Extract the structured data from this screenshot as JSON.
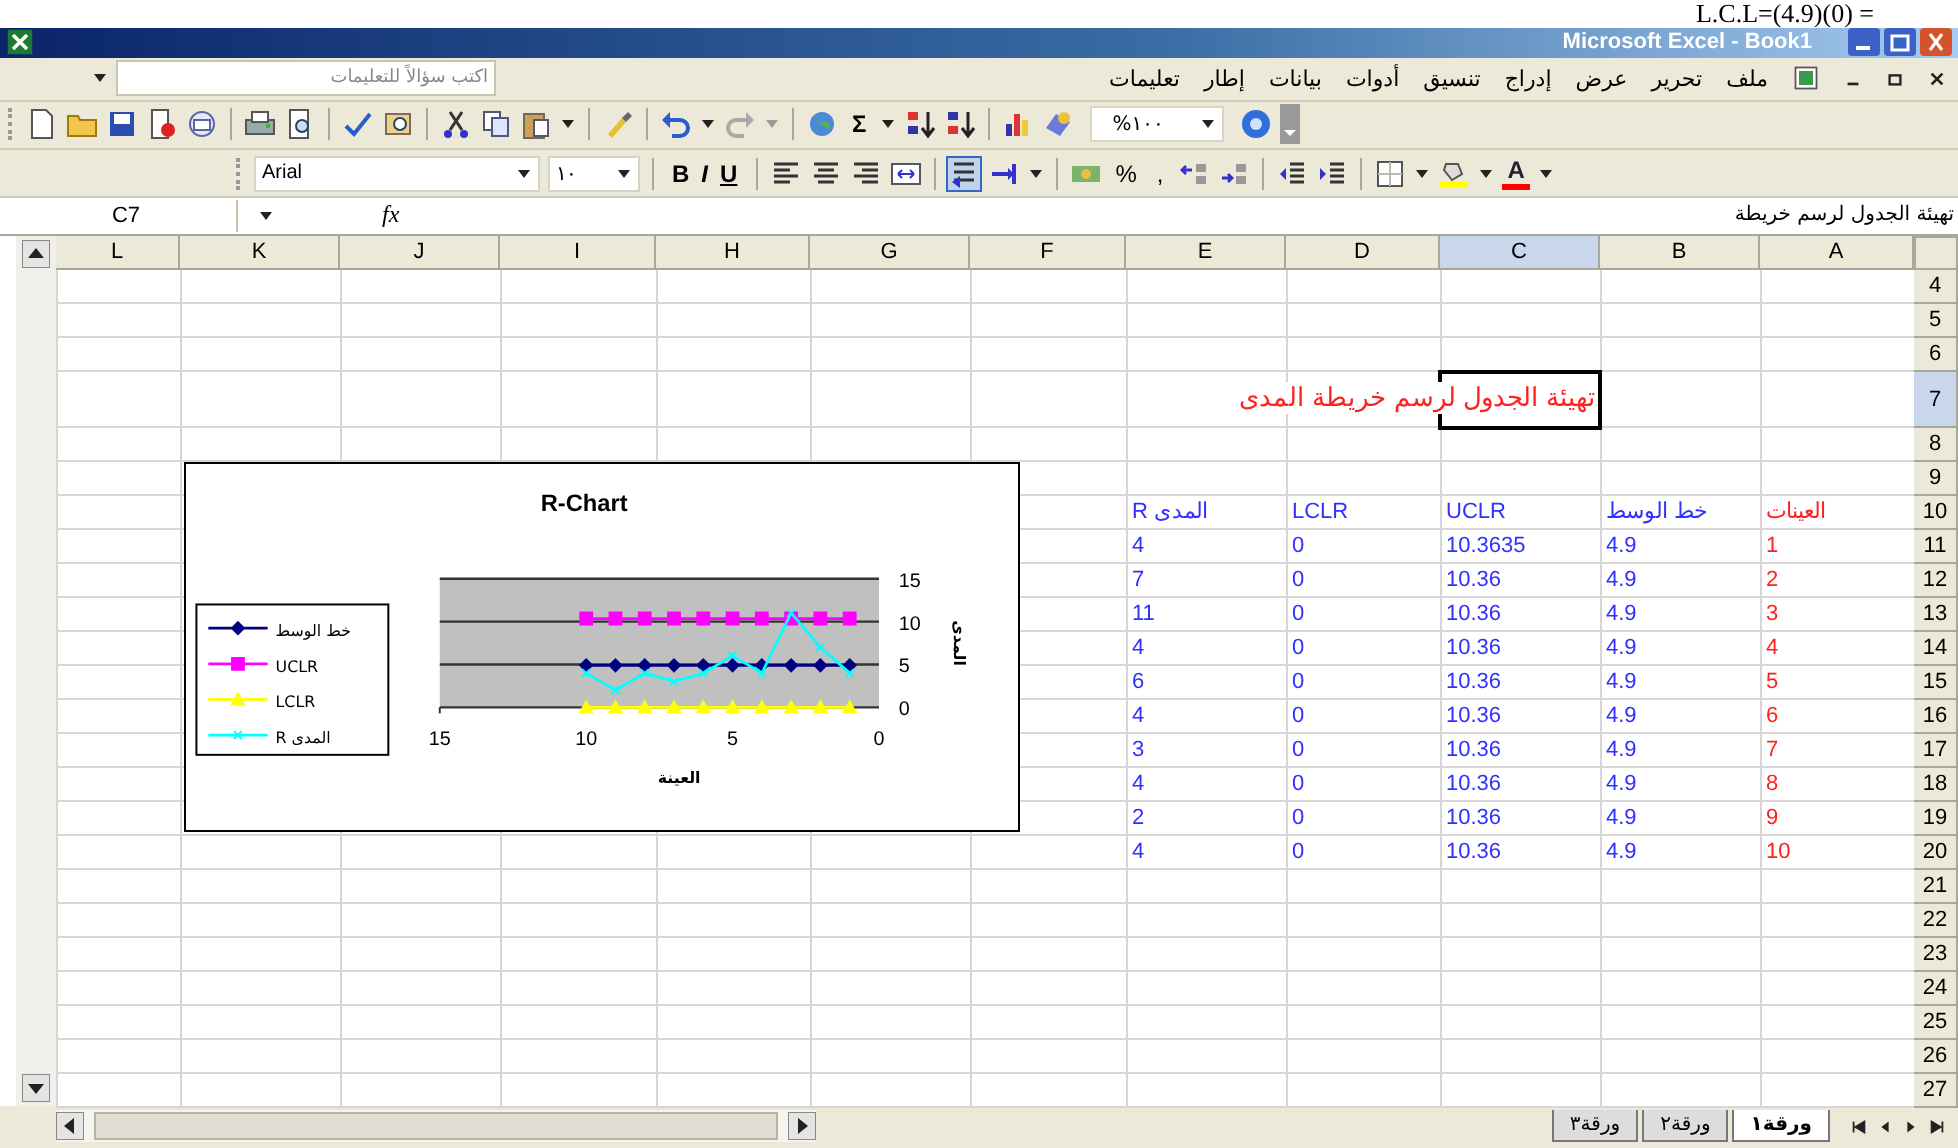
{
  "overlay_text": "L.C.L=(4.9)(0) =",
  "window": {
    "title": "Microsoft Excel - Book1"
  },
  "menu": [
    "ملف",
    "تحرير",
    "عرض",
    "إدراج",
    "تنسيق",
    "أدوات",
    "بيانات",
    "إطار",
    "تعليمات"
  ],
  "help_box": {
    "placeholder": "اكتب سؤالاً للتعليمات"
  },
  "standard_toolbar": {
    "autosum": "Σ",
    "zoom": "%١٠٠"
  },
  "formatting_toolbar": {
    "font": "Arial",
    "size": "١٠",
    "styles": [
      {
        "kind": "underline",
        "label": "U"
      },
      {
        "kind": "italic",
        "label": "I"
      },
      {
        "kind": "bold",
        "label": "B"
      }
    ],
    "percent": "%",
    "comma": ",",
    "font_color": "A"
  },
  "formula_bar": {
    "name_box": "C7",
    "fx": "fx",
    "content": "تهيئة الجدول لرسم خريطة"
  },
  "sheet": {
    "columns": [
      {
        "label": "A",
        "selected": false
      },
      {
        "label": "B",
        "selected": false
      },
      {
        "label": "C",
        "selected": true
      },
      {
        "label": "D",
        "selected": false
      },
      {
        "label": "E",
        "selected": false
      },
      {
        "label": "F",
        "selected": false
      },
      {
        "label": "G",
        "selected": false
      },
      {
        "label": "H",
        "selected": false
      },
      {
        "label": "I",
        "selected": false
      },
      {
        "label": "J",
        "selected": false
      },
      {
        "label": "K",
        "selected": false
      },
      {
        "label": "L",
        "selected": false
      }
    ],
    "rows": [
      {
        "label": "4",
        "selected": false
      },
      {
        "label": "5",
        "selected": false
      },
      {
        "label": "6",
        "selected": false
      },
      {
        "label": "7",
        "selected": true,
        "note": "تهيئة الجدول لرسم خريطة المدى"
      },
      {
        "label": "8",
        "selected": false
      },
      {
        "label": "9",
        "selected": false
      },
      {
        "label": "10",
        "selected": false,
        "cells": [
          "العينات",
          "خط الوسط",
          "UCLR",
          "LCLR",
          "R المدى"
        ]
      },
      {
        "label": "11",
        "selected": false,
        "cells": [
          "1",
          "4.9",
          "10.3635",
          "0",
          "4"
        ]
      },
      {
        "label": "12",
        "selected": false,
        "cells": [
          "2",
          "4.9",
          "10.36",
          "0",
          "7"
        ]
      },
      {
        "label": "13",
        "selected": false,
        "cells": [
          "3",
          "4.9",
          "10.36",
          "0",
          "11"
        ]
      },
      {
        "label": "14",
        "selected": false,
        "cells": [
          "4",
          "4.9",
          "10.36",
          "0",
          "4"
        ]
      },
      {
        "label": "15",
        "selected": false,
        "cells": [
          "5",
          "4.9",
          "10.36",
          "0",
          "6"
        ]
      },
      {
        "label": "16",
        "selected": false,
        "cells": [
          "6",
          "4.9",
          "10.36",
          "0",
          "4"
        ]
      },
      {
        "label": "17",
        "selected": false,
        "cells": [
          "7",
          "4.9",
          "10.36",
          "0",
          "3"
        ]
      },
      {
        "label": "18",
        "selected": false,
        "cells": [
          "8",
          "4.9",
          "10.36",
          "0",
          "4"
        ]
      },
      {
        "label": "19",
        "selected": false,
        "cells": [
          "9",
          "4.9",
          "10.36",
          "0",
          "2"
        ]
      },
      {
        "label": "20",
        "selected": false,
        "cells": [
          "10",
          "4.9",
          "10.36",
          "0",
          "4"
        ]
      },
      {
        "label": "21",
        "selected": false
      },
      {
        "label": "22",
        "selected": false
      },
      {
        "label": "23",
        "selected": false
      },
      {
        "label": "24",
        "selected": false
      },
      {
        "label": "25",
        "selected": false
      },
      {
        "label": "26",
        "selected": false
      },
      {
        "label": "27",
        "selected": false
      }
    ]
  },
  "chart": {
    "chart_data": {
      "type": "line",
      "title": "R-Chart",
      "xlabel": "العينة",
      "ylabel": "المدى",
      "x": [
        1,
        2,
        3,
        4,
        5,
        6,
        7,
        8,
        9,
        10
      ],
      "legend": "left",
      "series": [
        {
          "name": "خط الوسط",
          "color": "#000080",
          "marker": "diamond",
          "values": [
            4.9,
            4.9,
            4.9,
            4.9,
            4.9,
            4.9,
            4.9,
            4.9,
            4.9,
            4.9
          ]
        },
        {
          "name": "UCLR",
          "color": "#ff00ff",
          "marker": "square",
          "values": [
            10.36,
            10.36,
            10.36,
            10.36,
            10.36,
            10.36,
            10.36,
            10.36,
            10.36,
            10.36
          ]
        },
        {
          "name": "LCLR",
          "color": "#ffff00",
          "marker": "triangle",
          "values": [
            0,
            0,
            0,
            0,
            0,
            0,
            0,
            0,
            0,
            0
          ]
        },
        {
          "name": "R المدى",
          "color": "#00ffff",
          "marker": "cross",
          "values": [
            4,
            7,
            11,
            4,
            6,
            4,
            3,
            4,
            2,
            4
          ]
        }
      ],
      "xlim": [
        15,
        0
      ],
      "ylim": [
        0,
        15
      ],
      "xticks": [
        15,
        10,
        5,
        0
      ],
      "yticks": [
        0,
        5,
        10,
        15
      ]
    }
  },
  "sheet_tabs": [
    {
      "label": "ورقة١",
      "selected": true
    },
    {
      "label": "ورقة٢",
      "selected": false
    },
    {
      "label": "ورقة٣",
      "selected": false
    }
  ]
}
